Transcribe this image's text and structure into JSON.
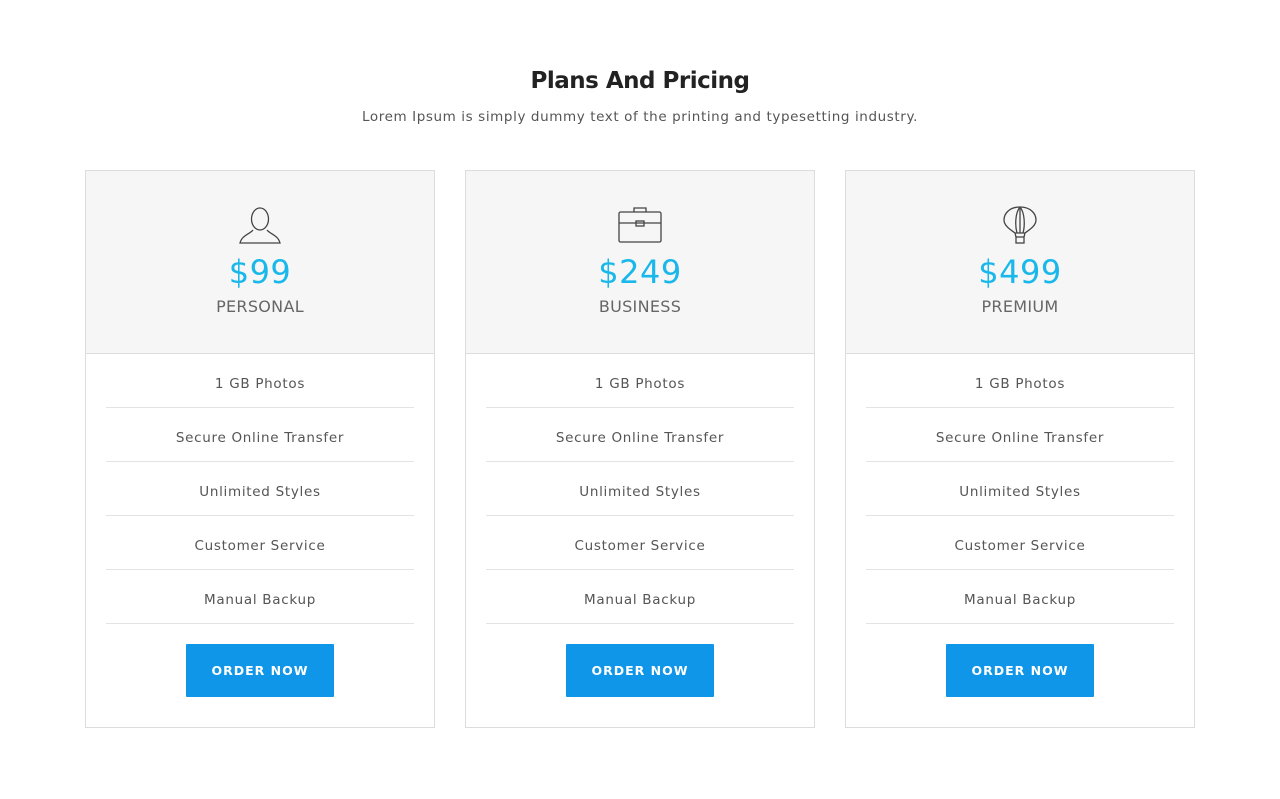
{
  "header": {
    "title": "Plans And Pricing",
    "subtitle": "Lorem Ipsum is simply dummy text of the printing and typesetting industry."
  },
  "colors": {
    "price": "#1ab8ea",
    "button": "#0f96e8",
    "card_header_bg": "#f6f6f6"
  },
  "plans": [
    {
      "icon": "user-icon",
      "price": "$99",
      "name": "PERSONAL",
      "features": [
        "1 GB Photos",
        "Secure Online Transfer",
        "Unlimited Styles",
        "Customer Service",
        "Manual Backup"
      ],
      "button_label": "ORDER NOW"
    },
    {
      "icon": "briefcase-icon",
      "price": "$249",
      "name": "BUSINESS",
      "features": [
        "1 GB Photos",
        "Secure Online Transfer",
        "Unlimited Styles",
        "Customer Service",
        "Manual Backup"
      ],
      "button_label": "ORDER NOW"
    },
    {
      "icon": "hot-air-balloon-icon",
      "price": "$499",
      "name": "PREMIUM",
      "features": [
        "1 GB Photos",
        "Secure Online Transfer",
        "Unlimited Styles",
        "Customer Service",
        "Manual Backup"
      ],
      "button_label": "ORDER NOW"
    }
  ]
}
